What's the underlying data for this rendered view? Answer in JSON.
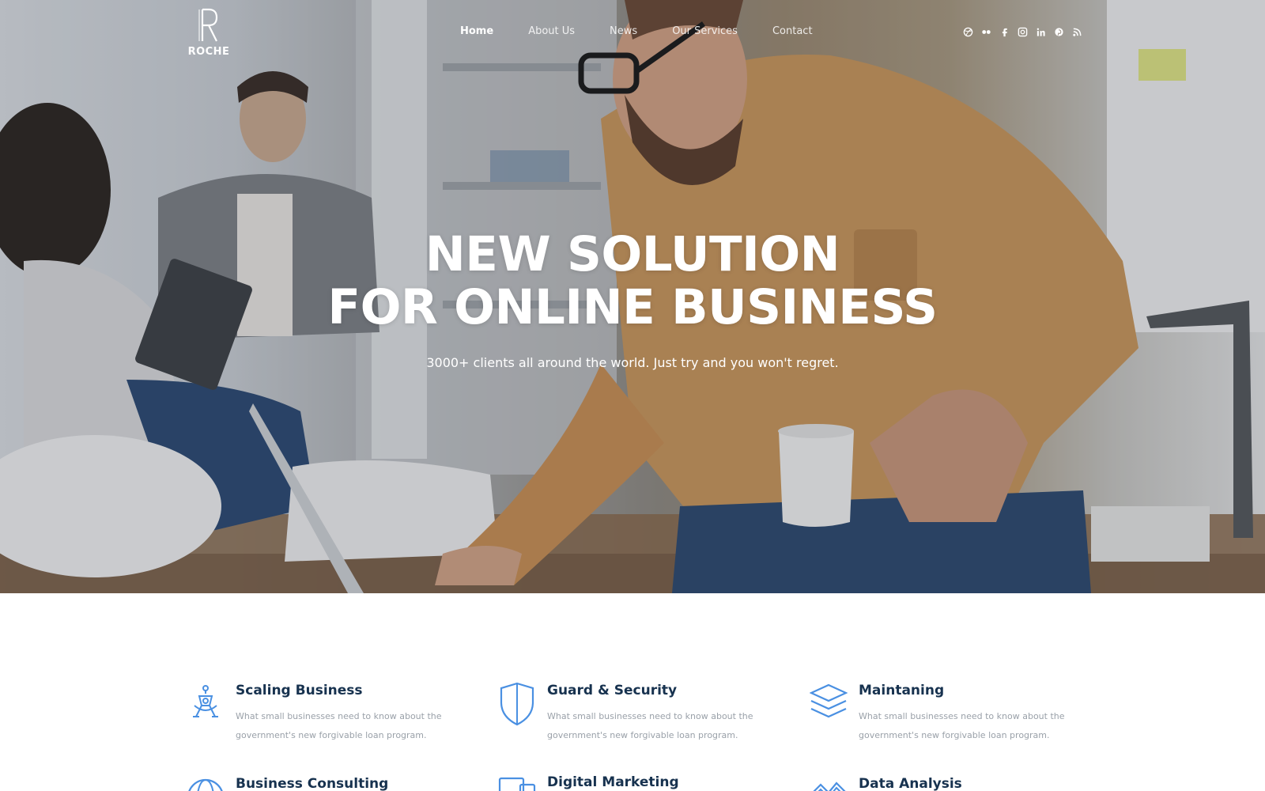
{
  "brand": {
    "name": "ROCHE"
  },
  "nav": {
    "items": [
      {
        "label": "Home"
      },
      {
        "label": "About Us"
      },
      {
        "label": "News"
      },
      {
        "label": "Our Services"
      },
      {
        "label": "Contact"
      }
    ]
  },
  "social": {
    "icons": [
      "dribbble-icon",
      "flickr-icon",
      "facebook-icon",
      "instagram-icon",
      "linkedin-icon",
      "pinterest-icon",
      "rss-icon"
    ]
  },
  "hero": {
    "title_line1": "NEW SOLUTION",
    "title_line2": "FOR ONLINE BUSINESS",
    "subtitle": "3000+ clients all around the world. Just try and you won't regret."
  },
  "features": [
    {
      "title": "Scaling Business",
      "description": "What small businesses need to know about the government's new forgivable loan program.",
      "icon": "rocket-person-icon"
    },
    {
      "title": "Guard & Security",
      "description": "What small businesses need to know about the government's new forgivable loan program.",
      "icon": "shield-icon"
    },
    {
      "title": "Maintaning",
      "description": "What small businesses need to know about the government's new forgivable loan program.",
      "icon": "layers-icon"
    },
    {
      "title": "Business Consulting",
      "description": "",
      "icon": "globe-icon"
    },
    {
      "title": "Digital Marketing",
      "description": "",
      "icon": "monitor-icon"
    },
    {
      "title": "Data Analysis",
      "description": "",
      "icon": "chart-icon"
    }
  ],
  "colors": {
    "accent": "#4a90e2",
    "heading": "#17324f",
    "muted": "#9aa1a9"
  }
}
